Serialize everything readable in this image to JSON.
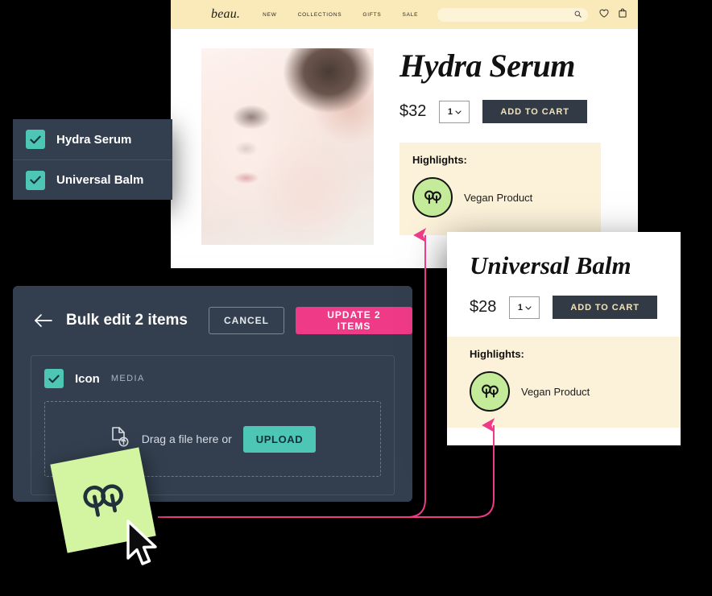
{
  "colors": {
    "page_background": "#000000",
    "panel_dark": "#333f4f",
    "accent_pink": "#ee3a87",
    "accent_teal": "#4ec6b5",
    "header_cream": "#fae9b9",
    "highlight_cream": "#fcf2da",
    "badge_green": "#c3eb9a",
    "cart_dark": "#323b45",
    "cart_text": "#f3e3b9"
  },
  "storefront": {
    "logo": "beau.",
    "nav": [
      {
        "label": "NEW"
      },
      {
        "label": "COLLECTIONS"
      },
      {
        "label": "GIFTS"
      },
      {
        "label": "SALE"
      }
    ],
    "search": {
      "value": "",
      "placeholder": ""
    },
    "icons": [
      {
        "name": "search-icon"
      },
      {
        "name": "heart-icon"
      },
      {
        "name": "shopping-bag-icon"
      }
    ],
    "product": {
      "title": "Hydra Serum",
      "price": "$32",
      "quantity": "1",
      "add_to_cart_label": "ADD TO CART",
      "highlights_title": "Highlights:",
      "highlights": [
        {
          "icon": "vegan-trees-icon",
          "label": "Vegan Product"
        }
      ]
    }
  },
  "product_list": {
    "items": [
      {
        "label": "Hydra Serum",
        "checked": true
      },
      {
        "label": "Universal Balm",
        "checked": true
      }
    ]
  },
  "bulk_edit": {
    "back_icon": "arrow-left-icon",
    "title": "Bulk edit 2 items",
    "cancel_label": "CANCEL",
    "update_label": "UPDATE 2 ITEMS",
    "field": {
      "checked": true,
      "name": "Icon",
      "kind": "MEDIA",
      "dropzone_text": "Drag a file here or",
      "upload_label": "UPLOAD",
      "dropzone_icon": "file-upload-icon"
    }
  },
  "balm_card": {
    "title": "Universal Balm",
    "price": "$28",
    "quantity": "1",
    "add_to_cart_label": "ADD TO CART",
    "highlights_title": "Highlights:",
    "highlights": [
      {
        "icon": "vegan-trees-icon",
        "label": "Vegan Product"
      }
    ]
  },
  "drag": {
    "sticker_icon": "vegan-trees-icon",
    "cursor_icon": "mouse-pointer-icon"
  }
}
